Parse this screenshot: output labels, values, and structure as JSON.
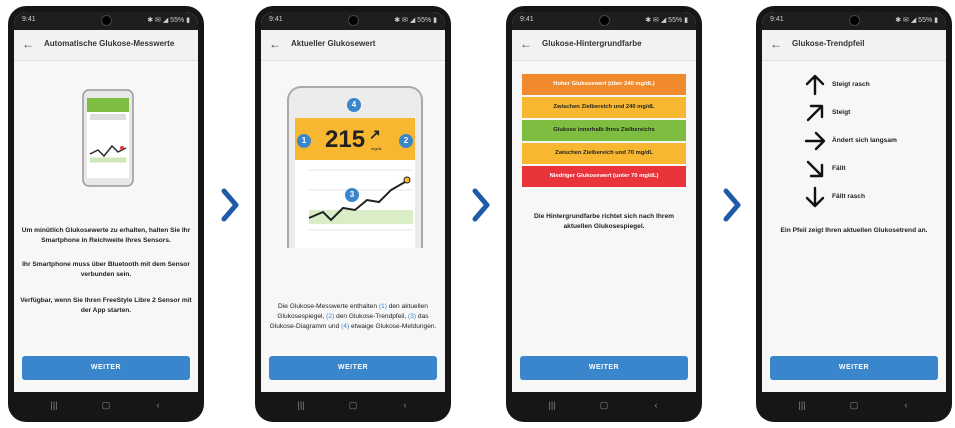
{
  "status": {
    "time": "9:41",
    "icons": "✱ ✉ ◢ 55% ▮"
  },
  "weiter_label": "WEITER",
  "nav": {
    "recents": "|||",
    "home": "▢",
    "back": "‹"
  },
  "screens": [
    {
      "title": "Automatische Glukose-Messwerte",
      "paragraphs": [
        "Um minütlich Glukosewerte zu erhalten, halten Sie Ihr Smartphone in Reichweite Ihres Sensors.",
        "Ihr Smartphone muss über Bluetooth mit dem Sensor verbunden sein.",
        "Verfügbar, wenn Sie Ihren FreeStyle Libre 2 Sensor mit der App starten."
      ]
    },
    {
      "title": "Aktueller Glukosewert",
      "reading": "215",
      "unit": "mg/dL",
      "badges": [
        "1",
        "2",
        "3",
        "4"
      ],
      "desc_parts": [
        "Die Glukose-Messwerte enthalten ",
        "(1)",
        " den aktuellen Glukosespiegel, ",
        "(2)",
        " den Glukose-Trendpfeil, ",
        "(3)",
        " das Glukose-Diagramm und ",
        "(4)",
        " etwaige Glukose-Meldungen."
      ]
    },
    {
      "title": "Glukose-Hintergrundfarbe",
      "bars": [
        {
          "label": "Hoher Glukosewert (über 240 mg/dL)",
          "color": "#f08a2c"
        },
        {
          "label": "Zwischen Zielbereich und 240 mg/dL",
          "color": "#f7b731"
        },
        {
          "label": "Glukose innerhalb Ihres Zielbereichs",
          "color": "#7dbd3f"
        },
        {
          "label": "Zwischen Zielbereich und 70 mg/dL",
          "color": "#f7b731"
        },
        {
          "label": "Niedriger Glukosewert (unter 70 mg/dL)",
          "color": "#e8343a"
        }
      ],
      "description": "Die Hintergrundfarbe richtet sich nach Ihrem aktuellen Glukosespiegel."
    },
    {
      "title": "Glukose-Trendpfeil",
      "trends": [
        {
          "label": "Steigt rasch",
          "icon": "arrow-up-icon"
        },
        {
          "label": "Steigt",
          "icon": "arrow-up-right-icon"
        },
        {
          "label": "Ändert sich langsam",
          "icon": "arrow-right-icon"
        },
        {
          "label": "Fällt",
          "icon": "arrow-down-right-icon"
        },
        {
          "label": "Fällt rasch",
          "icon": "arrow-down-icon"
        }
      ],
      "description": "Ein Pfeil zeigt Ihren aktuellen Glukosetrend an."
    }
  ],
  "colors": {
    "accent": "#3a86cc",
    "chevron": "#1f5aa8",
    "badge": "#3a86cc",
    "reading_bg": "#f7b731"
  }
}
